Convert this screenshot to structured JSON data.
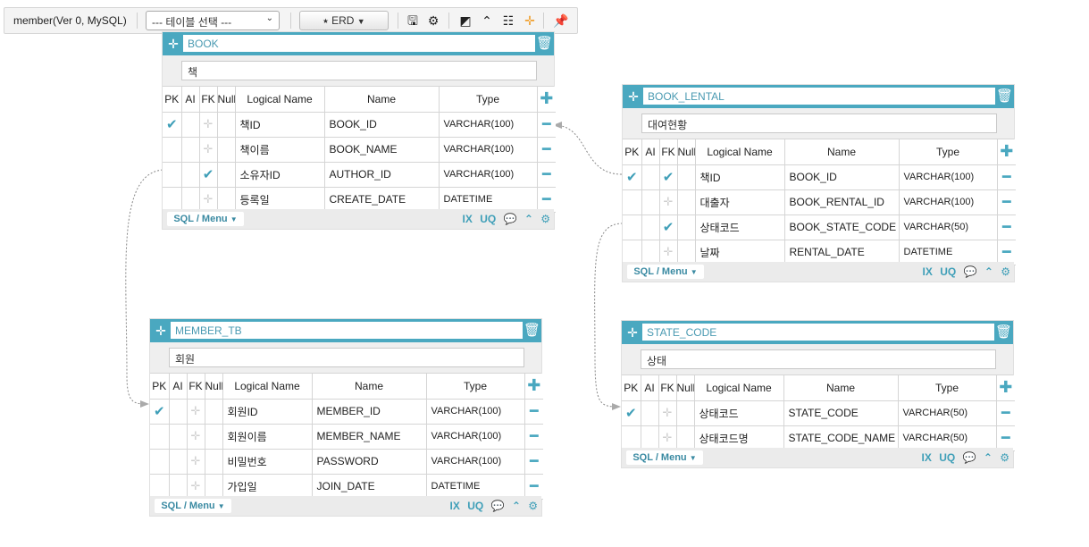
{
  "toolbar": {
    "title": "member(Ver 0, MySQL)",
    "table_select": "--- 테이블 선택 ---",
    "erd_label": "ERD",
    "icons": [
      "save-icon",
      "gear-icon",
      "aspect-icon",
      "caret-up-icon",
      "grid-icon",
      "move-icon",
      "pin-icon"
    ]
  },
  "columns_header": {
    "pk": "PK",
    "ai": "AI",
    "fk": "FK",
    "null": "Null",
    "logical": "Logical Name",
    "name": "Name",
    "type": "Type"
  },
  "footer": {
    "sql_menu": "SQL / Menu",
    "ix": "IX",
    "uq": "UQ"
  },
  "tables": {
    "book": {
      "name": "BOOK",
      "comment": "책",
      "rows": [
        {
          "pk": true,
          "fk": false,
          "logical": "책ID",
          "name": "BOOK_ID",
          "type": "VARCHAR(100)"
        },
        {
          "pk": false,
          "fk": false,
          "logical": "책이름",
          "name": "BOOK_NAME",
          "type": "VARCHAR(100)"
        },
        {
          "pk": false,
          "fk": true,
          "logical": "소유자ID",
          "name": "AUTHOR_ID",
          "type": "VARCHAR(100)"
        },
        {
          "pk": false,
          "fk": false,
          "logical": "등록일",
          "name": "CREATE_DATE",
          "type": "DATETIME"
        }
      ]
    },
    "book_lental": {
      "name": "BOOK_LENTAL",
      "comment": "대여현황",
      "rows": [
        {
          "pk": true,
          "fk": true,
          "logical": "책ID",
          "name": "BOOK_ID",
          "type": "VARCHAR(100)"
        },
        {
          "pk": false,
          "fk": false,
          "logical": "대출자",
          "name": "BOOK_RENTAL_ID",
          "type": "VARCHAR(100)"
        },
        {
          "pk": false,
          "fk": true,
          "logical": "상태코드",
          "name": "BOOK_STATE_CODE",
          "type": "VARCHAR(50)"
        },
        {
          "pk": false,
          "fk": false,
          "logical": "날짜",
          "name": "RENTAL_DATE",
          "type": "DATETIME"
        }
      ]
    },
    "member_tb": {
      "name": "MEMBER_TB",
      "comment": "회원",
      "rows": [
        {
          "pk": true,
          "fk": false,
          "logical": "회원ID",
          "name": "MEMBER_ID",
          "type": "VARCHAR(100)"
        },
        {
          "pk": false,
          "fk": false,
          "logical": "회원이름",
          "name": "MEMBER_NAME",
          "type": "VARCHAR(100)"
        },
        {
          "pk": false,
          "fk": false,
          "logical": "비밀번호",
          "name": "PASSWORD",
          "type": "VARCHAR(100)"
        },
        {
          "pk": false,
          "fk": false,
          "logical": "가입일",
          "name": "JOIN_DATE",
          "type": "DATETIME"
        }
      ]
    },
    "state_code": {
      "name": "STATE_CODE",
      "comment": "상태",
      "rows": [
        {
          "pk": true,
          "fk": false,
          "logical": "상태코드",
          "name": "STATE_CODE",
          "type": "VARCHAR(50)"
        },
        {
          "pk": false,
          "fk": false,
          "logical": "상태코드명",
          "name": "STATE_CODE_NAME",
          "type": "VARCHAR(50)"
        }
      ]
    }
  }
}
